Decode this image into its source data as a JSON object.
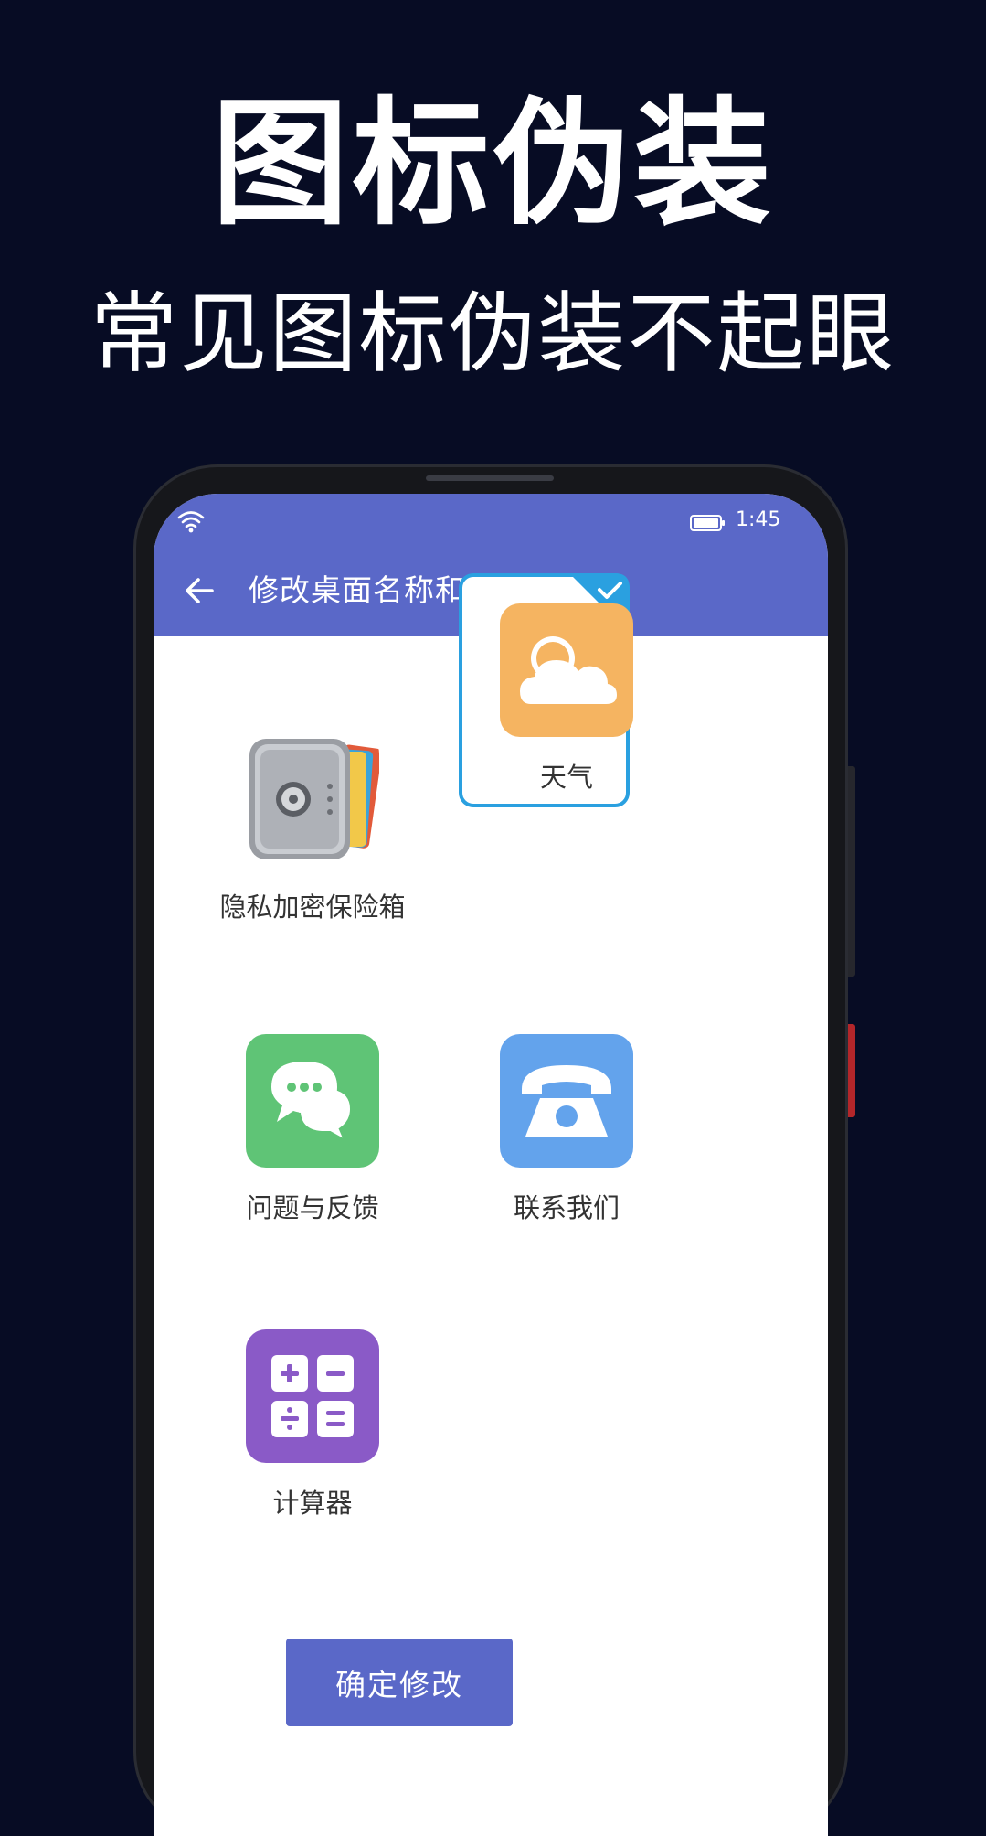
{
  "promo": {
    "headline": "图标伪装",
    "subline": "常见图标伪装不起眼"
  },
  "status_bar": {
    "time": "1:45",
    "wifi_icon": "wifi-icon",
    "battery_icon": "battery-icon"
  },
  "app_bar": {
    "title": "修改桌面名称和图标",
    "back_icon": "back-arrow-icon",
    "color": "#5a68c8"
  },
  "icons": [
    {
      "label": "隐私加密保险箱",
      "icon": "safe-vault-icon",
      "selected": false
    },
    {
      "label": "天气",
      "icon": "weather-cloud-icon",
      "color": "#f5b461",
      "selected": true
    },
    {
      "label": "问题与反馈",
      "icon": "chat-bubbles-icon",
      "color": "#5fc476",
      "selected": false
    },
    {
      "label": "联系我们",
      "icon": "telephone-icon",
      "color": "#63a3ec",
      "selected": false
    },
    {
      "label": "计算器",
      "icon": "calculator-icon",
      "color": "#8a5ac7",
      "selected": false
    }
  ],
  "confirm_button": {
    "label": "确定修改"
  },
  "colors": {
    "background": "#070c24",
    "selection": "#2aa0e0"
  }
}
